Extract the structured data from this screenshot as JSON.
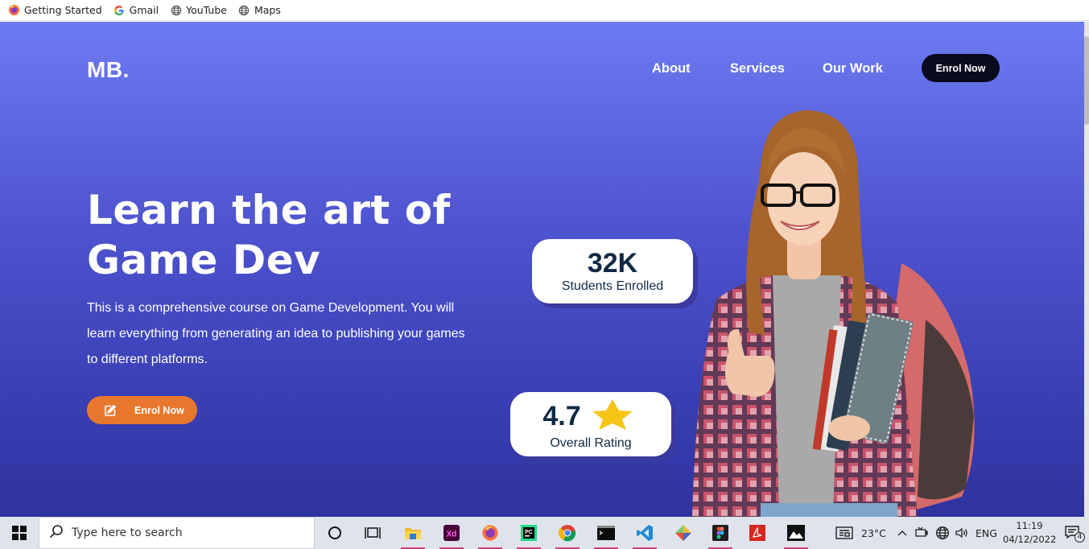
{
  "bookmarks": [
    {
      "label": "Getting Started",
      "icon": "firefox-icon"
    },
    {
      "label": "Gmail",
      "icon": "google-icon"
    },
    {
      "label": "YouTube",
      "icon": "globe-icon"
    },
    {
      "label": "Maps",
      "icon": "globe-icon"
    }
  ],
  "header": {
    "logo": "MB.",
    "nav": [
      "About",
      "Services",
      "Our Work"
    ],
    "cta_label": "Enrol Now"
  },
  "hero": {
    "headline_line1": "Learn the art of",
    "headline_line2": "Game Dev",
    "description": "This is a comprehensive course on Game Development. You will learn everything from generating an idea to publishing your games to different platforms.",
    "cta_label": "Enrol Now",
    "cta_color": "#e8772e"
  },
  "stats": [
    {
      "value": "32K",
      "label": "Students Enrolled"
    },
    {
      "value": "4.7",
      "label": "Overall Rating",
      "icon": "star-icon"
    }
  ],
  "taskbar": {
    "search_placeholder": "Type here to search",
    "weather": "23°C",
    "language": "ENG",
    "time": "11:19",
    "date": "04/12/2022",
    "notifications": "4"
  },
  "colors": {
    "accent_dark": "#0a0a1e",
    "stat_text": "#0f2a44",
    "star": "#f5c518"
  }
}
